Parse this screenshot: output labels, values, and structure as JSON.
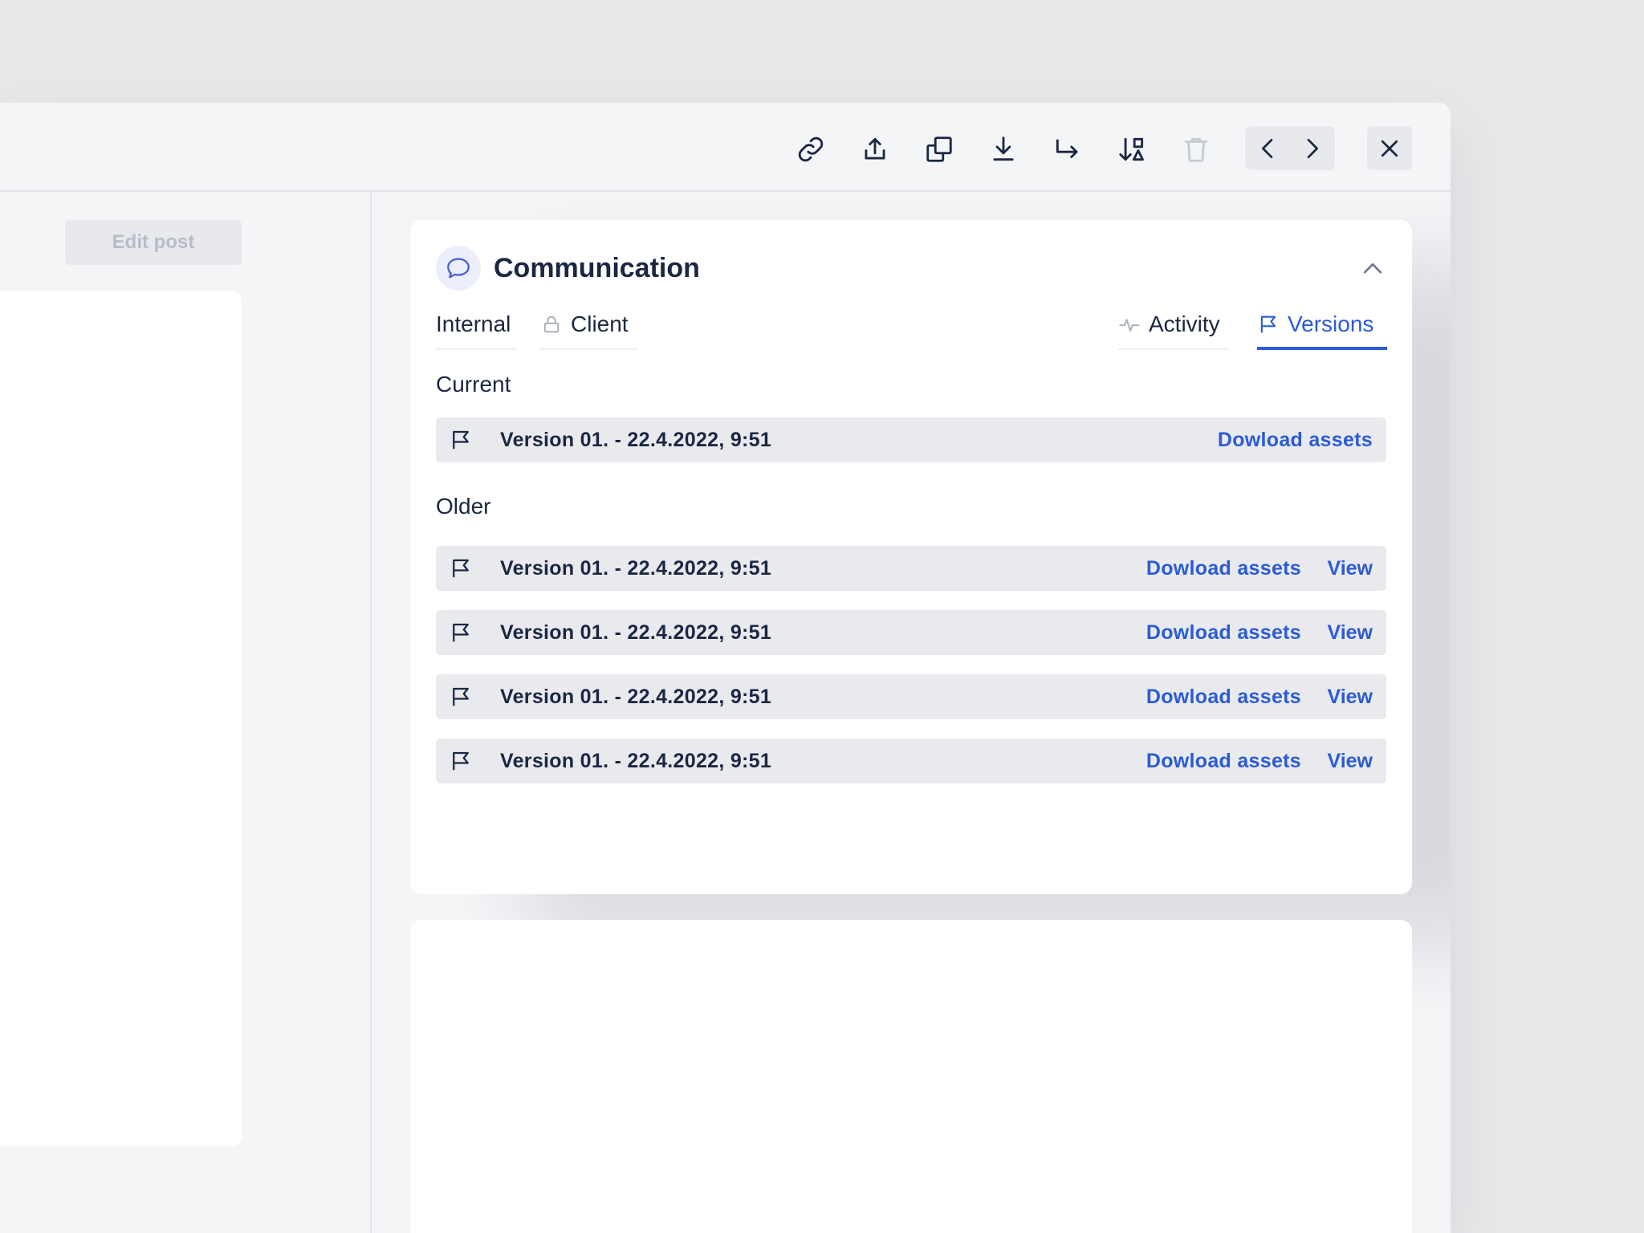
{
  "toolbar": {
    "icons": [
      "link-icon",
      "upload-icon",
      "copy-icon",
      "download-icon",
      "forward-icon",
      "sort-icon",
      "trash-icon"
    ],
    "nav_prev_icon": "chevron-left-icon",
    "nav_next_icon": "chevron-right-icon",
    "close_icon": "close-icon"
  },
  "left_panel": {
    "edit_post_label": "Edit post"
  },
  "communication": {
    "title": "Communication",
    "icon": "chat-bubble-icon",
    "tabs": [
      {
        "label": "Internal",
        "icon": ""
      },
      {
        "label": "Client",
        "icon": "lock-icon"
      },
      {
        "label": "Activity",
        "icon": "activity-icon"
      },
      {
        "label": "Versions",
        "icon": "flag-icon",
        "active": true
      }
    ],
    "current_label": "Current",
    "older_label": "Older",
    "current_version": {
      "text": "Version 01. - 22.4.2022, 9:51",
      "download_label": "Dowload assets"
    },
    "older_versions": [
      {
        "text": "Version 01. - 22.4.2022, 9:51",
        "download_label": "Dowload assets",
        "view_label": "View"
      },
      {
        "text": "Version 01. - 22.4.2022, 9:51",
        "download_label": "Dowload assets",
        "view_label": "View"
      },
      {
        "text": "Version 01. - 22.4.2022, 9:51",
        "download_label": "Dowload assets",
        "view_label": "View"
      },
      {
        "text": "Version 01. - 22.4.2022, 9:51",
        "download_label": "Dowload assets",
        "view_label": "View"
      }
    ]
  },
  "colors": {
    "accent": "#2b5bd6",
    "text": "#1b2742",
    "row_bg": "#e9eaee"
  }
}
